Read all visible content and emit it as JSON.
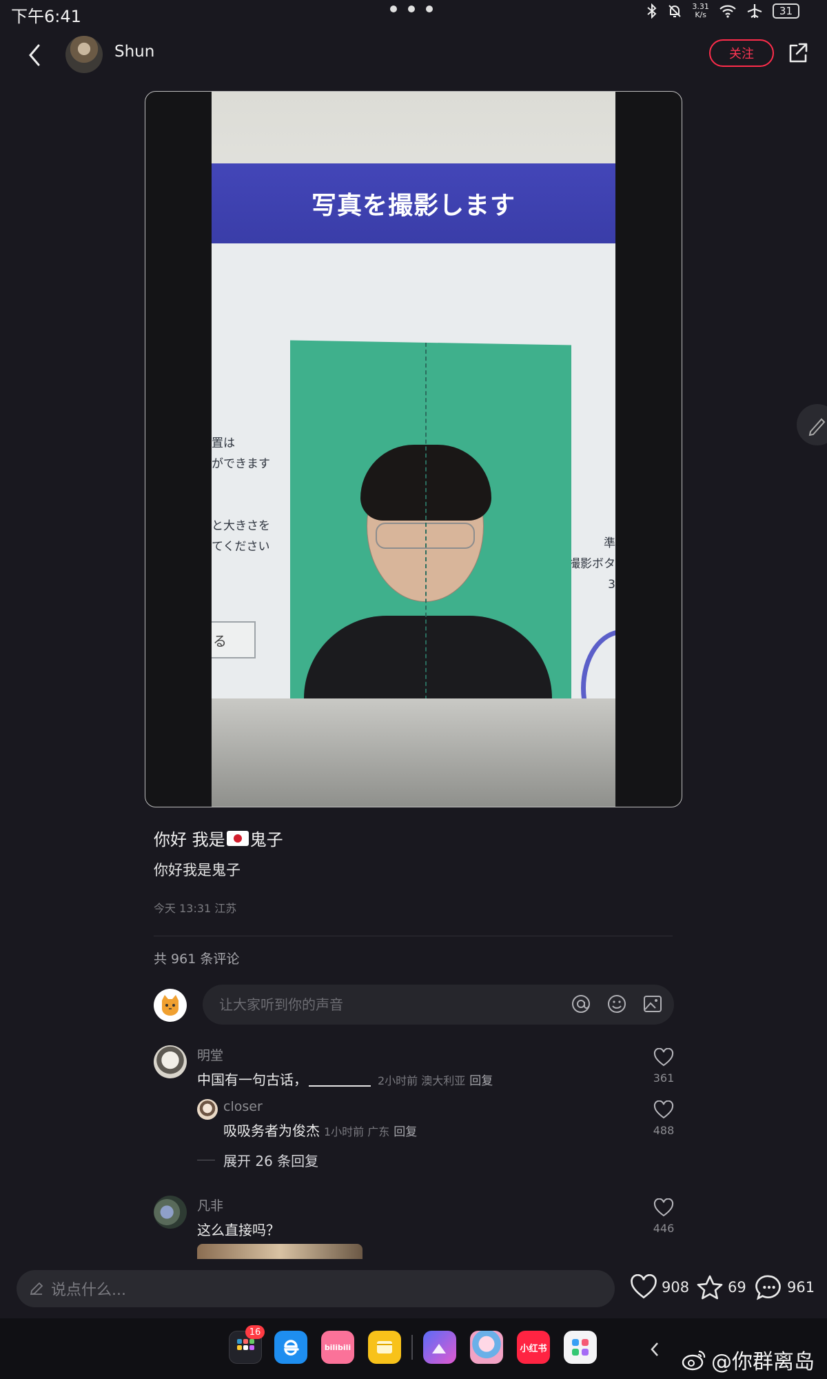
{
  "status_bar": {
    "time": "下午6:41",
    "net_speed_top": "3.31",
    "net_speed_unit": "K/s",
    "battery": "31"
  },
  "header": {
    "author": "Shun",
    "follow_label": "关注"
  },
  "media": {
    "banner_text": "写真を撮影します",
    "left_text_lines": [
      "置は",
      "ができます",
      "",
      "",
      "と大きさを",
      "てください"
    ],
    "right_text_lines": [
      "準",
      "撮影ボタ",
      "3"
    ],
    "left_button_text": "る"
  },
  "post": {
    "title_pre": "你好 我是",
    "title_post": "鬼子",
    "body": "你好我是鬼子",
    "meta": "今天 13:31 江苏",
    "comment_count_label": "共 961 条评论"
  },
  "comment_input": {
    "placeholder": "让大家听到你的声音"
  },
  "comments": [
    {
      "name": "明堂",
      "text": "中国有一句古话，",
      "time": "2小时前  澳大利亚",
      "reply": "回复",
      "likes": "361"
    },
    {
      "name": "closer",
      "text": "吸吸务者为俊杰",
      "time": "1小时前  广东",
      "reply": "回复",
      "likes": "488"
    },
    {
      "name": "凡非",
      "text": "这么直接吗？",
      "likes": "446"
    }
  ],
  "expand_replies": "展开 26 条回复",
  "bottom_bar": {
    "say_placeholder": "说点什么...",
    "likes": "908",
    "stars": "69",
    "comments": "961"
  },
  "dock": {
    "badge": "16",
    "xhs_label": "小红书",
    "bili_label": "bilibili",
    "watermark": "@你群离岛"
  },
  "colors": {
    "background": "#19181f",
    "accent_red": "#ff2d4b",
    "muted_text": "#7b7b80"
  }
}
